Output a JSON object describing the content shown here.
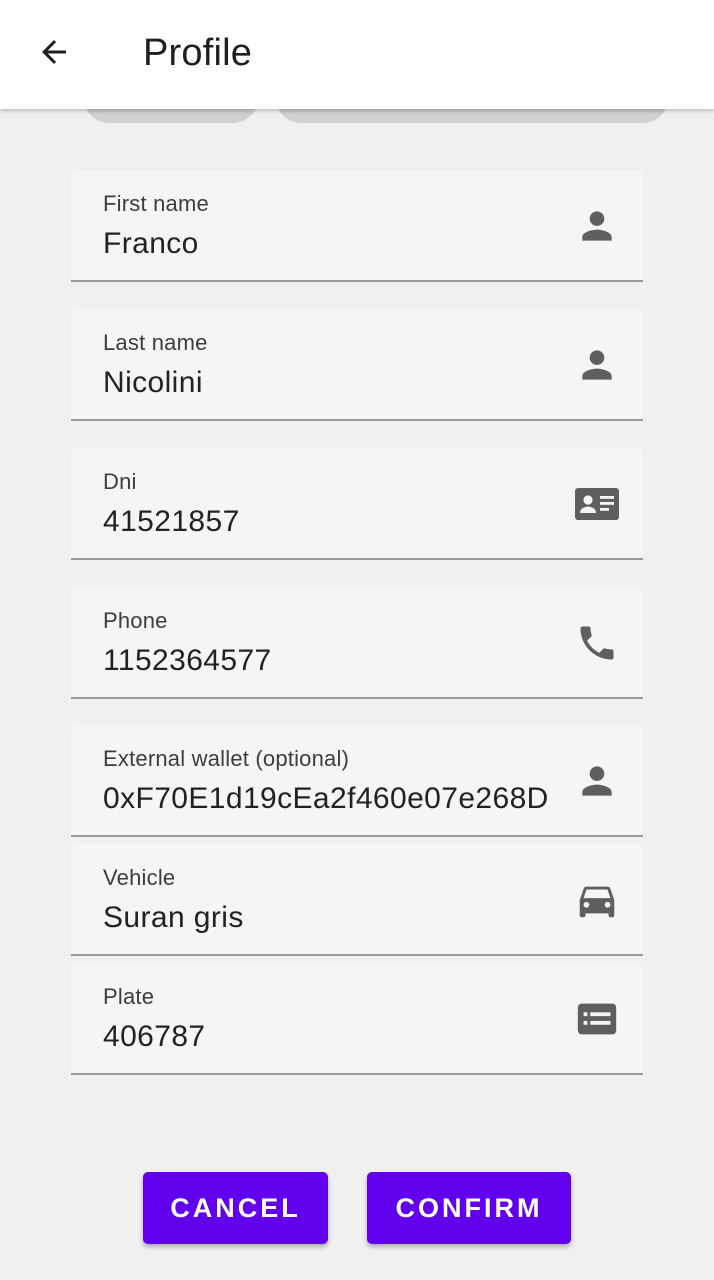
{
  "header": {
    "title": "Profile",
    "back_icon": "arrow-back-icon"
  },
  "fields": [
    {
      "label": "First name",
      "value": "Franco",
      "icon": "person-icon"
    },
    {
      "label": "Last name",
      "value": "Nicolini",
      "icon": "person-icon"
    },
    {
      "label": "Dni",
      "value": "41521857",
      "icon": "id-card-icon"
    },
    {
      "label": "Phone",
      "value": "1152364577",
      "icon": "phone-icon"
    },
    {
      "label": "External wallet (optional)",
      "value": "0xF70E1d19cEa2f460e07e268D",
      "icon": "person-icon"
    },
    {
      "label": "Vehicle",
      "value": "Suran gris",
      "icon": "car-icon"
    },
    {
      "label": "Plate",
      "value": "406787",
      "icon": "plate-icon"
    }
  ],
  "actions": {
    "cancel_label": "CANCEL",
    "confirm_label": "CONFIRM"
  },
  "colors": {
    "accent": "#6200ee",
    "icon": "#5f5f5f",
    "field_bg": "#f5f5f5",
    "page_bg": "#f0f0f0"
  }
}
